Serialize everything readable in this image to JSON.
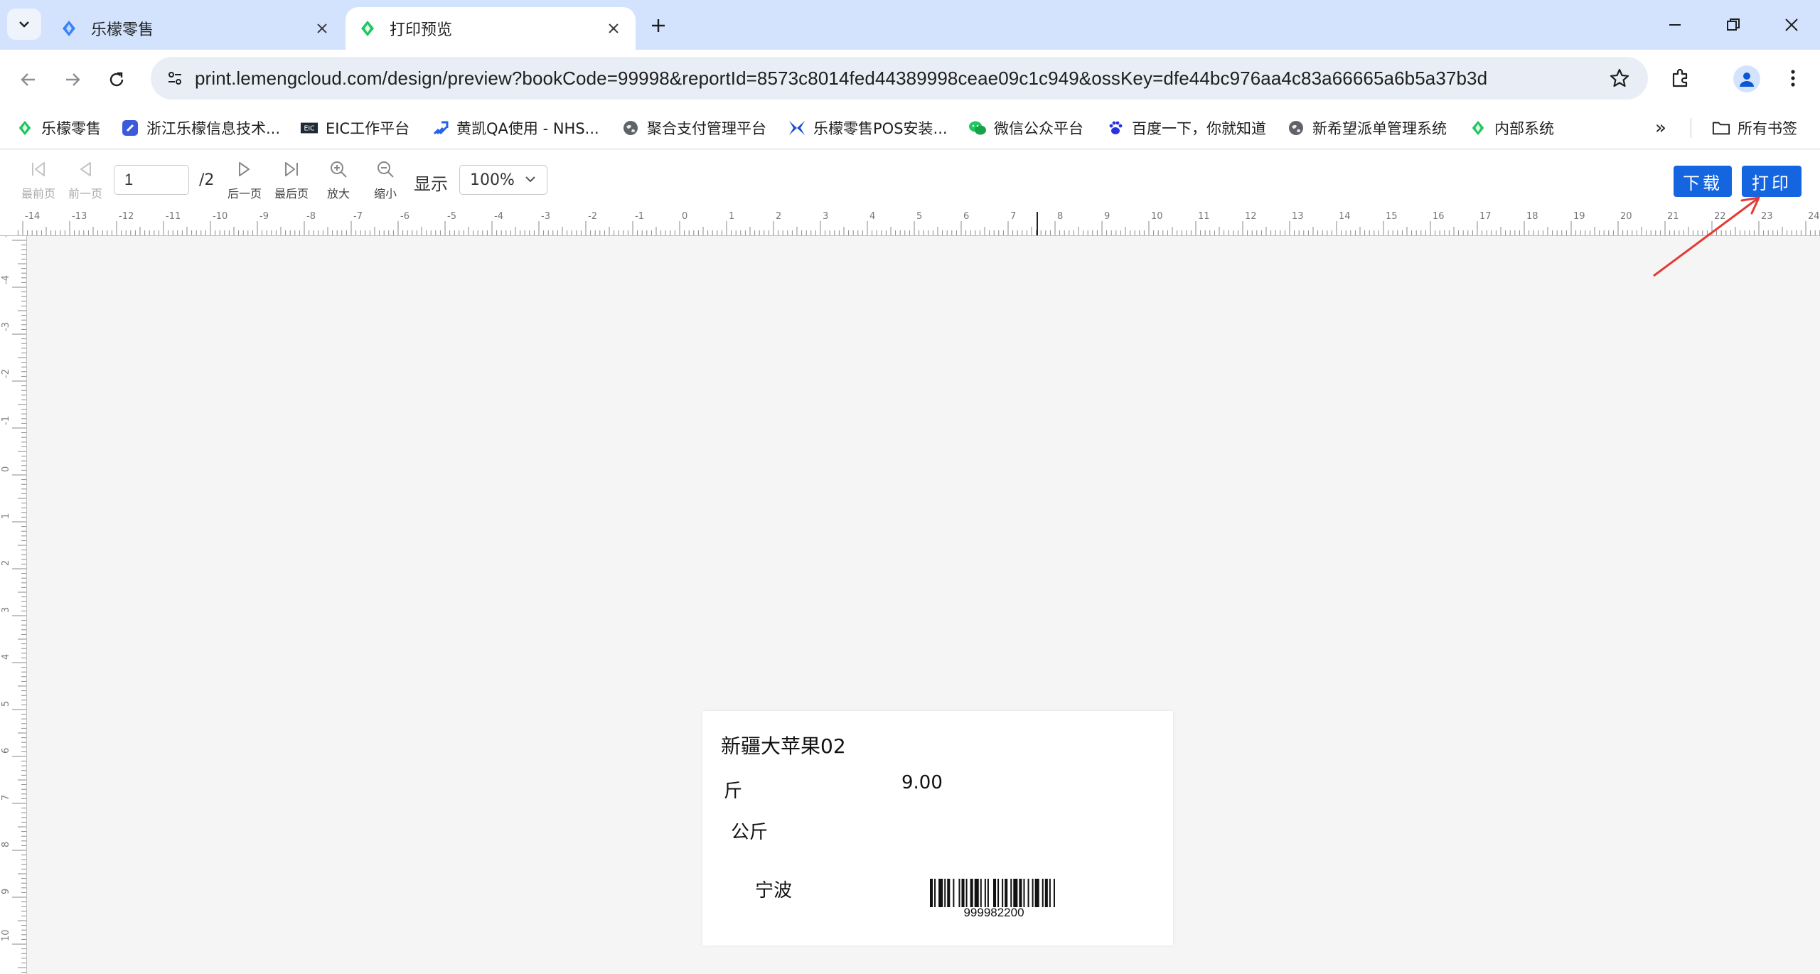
{
  "tabs": [
    {
      "title": "乐檬零售",
      "active": false
    },
    {
      "title": "打印预览",
      "active": true
    }
  ],
  "address_bar": {
    "url": "print.lemengcloud.com/design/preview?bookCode=99998&reportId=8573c8014fed44389998ceae09c1c949&ossKey=dfe44bc976aa4c83a66665a6b5a37b3d"
  },
  "bookmarks": [
    {
      "label": "乐檬零售",
      "icon": "lemeng-leaf-icon"
    },
    {
      "label": "浙江乐檬信息技术...",
      "icon": "blue-badge-icon"
    },
    {
      "label": "EIC工作平台",
      "icon": "eic-icon"
    },
    {
      "label": "黄凯QA使用 - NHS...",
      "icon": "jira-icon"
    },
    {
      "label": "聚合支付管理平台",
      "icon": "globe-icon"
    },
    {
      "label": "乐檬零售POS安装...",
      "icon": "butterfly-icon"
    },
    {
      "label": "微信公众平台",
      "icon": "wechat-icon"
    },
    {
      "label": "百度一下，你就知道",
      "icon": "baidu-paw-icon"
    },
    {
      "label": "新希望派单管理系统",
      "icon": "globe-icon"
    },
    {
      "label": "内部系统",
      "icon": "lemeng-leaf-icon"
    }
  ],
  "bookmarks_more": "»",
  "all_bookmarks": "所有书签",
  "preview_toolbar": {
    "first_page": "最前页",
    "prev_page": "前一页",
    "page_value": "1",
    "page_total": "/2",
    "next_page": "后一页",
    "last_page": "最后页",
    "zoom_in": "放大",
    "zoom_out": "缩小",
    "display_label": "显示",
    "zoom_value": "100%",
    "download": "下载",
    "print": "打印"
  },
  "label": {
    "product_name": "新疆大苹果02",
    "unit": "斤",
    "price": "9.00",
    "unit2": "公斤",
    "origin": "宁波",
    "barcode": "999982200"
  },
  "colors": {
    "tabstrip": "#d3e3fd",
    "accent_button": "#1565e0",
    "annotation_arrow": "#e53935"
  }
}
